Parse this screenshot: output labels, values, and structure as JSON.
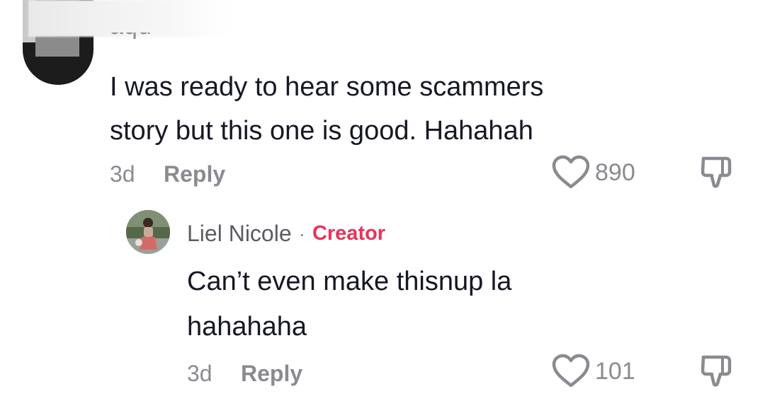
{
  "comment": {
    "username_partial": "aqu",
    "text_line1": "I was ready to hear some scammers",
    "text_line2": "story but this one is good. Hahahah",
    "age": "3d",
    "reply_label": "Reply",
    "likes": "890",
    "like_icon": "heart-outline-icon",
    "dislike_icon": "thumbs-down-icon"
  },
  "reply": {
    "author": "Liel Nicole",
    "separator": "·",
    "badge": "Creator",
    "text_line1": "Can’t even make thisnup la",
    "text_line2": "hahahaha",
    "age": "3d",
    "reply_label": "Reply",
    "likes": "101",
    "like_icon": "heart-outline-icon",
    "dislike_icon": "thumbs-down-icon"
  },
  "colors": {
    "text_primary": "#161823",
    "text_secondary": "#8a8b91",
    "creator_badge": "#e8325a"
  }
}
